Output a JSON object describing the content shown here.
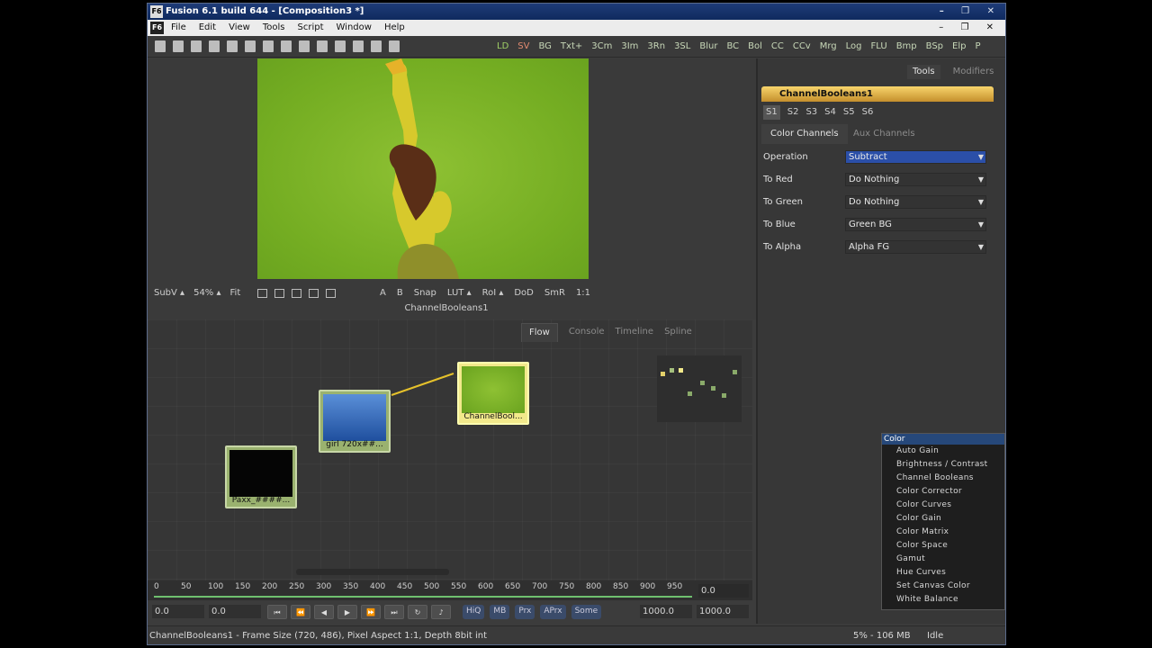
{
  "window": {
    "title": "Fusion 6.1 build 644 - [Composition3 *]",
    "logo": "F6",
    "buttons": "– ❐ ✕"
  },
  "menu": {
    "logo": "F6",
    "items": [
      "File",
      "Edit",
      "View",
      "Tools",
      "Script",
      "Window",
      "Help"
    ],
    "buttons": "– ❐ ✕"
  },
  "toolbar": {
    "tools": [
      "LD",
      "SV",
      "BG",
      "Txt+",
      "3Cm",
      "3Im",
      "3Rn",
      "3SL",
      "Blur",
      "BC",
      "Bol",
      "CC",
      "CCv",
      "Mrg",
      "Log",
      "FLU",
      "Bmp",
      "BSp",
      "Elp",
      "P"
    ]
  },
  "viewer": {
    "controls_left": [
      "SubV ▴",
      "54% ▴",
      "Fit"
    ],
    "controls_right": [
      "A",
      "B",
      "Snap",
      "LUT ▴",
      "RoI ▴",
      "DoD",
      "SmR",
      "1:1"
    ],
    "label": "ChannelBooleans1"
  },
  "flow": {
    "tabs": [
      "Flow",
      "Console",
      "Timeline",
      "Spline"
    ],
    "nodes": [
      {
        "label": "girl 720x##..."
      },
      {
        "label": "ChannelBool..."
      },
      {
        "label": "Paxx_####..."
      }
    ]
  },
  "sidebar": {
    "tabs": [
      "Tools",
      "Modifiers"
    ],
    "tool_name": "ChannelBooleans1",
    "slots": [
      "S1",
      "S2",
      "S3",
      "S4",
      "S5",
      "S6"
    ],
    "channel_tabs": [
      "Color Channels",
      "Aux Channels"
    ],
    "params": [
      {
        "label": "Operation",
        "value": "Subtract"
      },
      {
        "label": "To Red",
        "value": "Do Nothing"
      },
      {
        "label": "To Green",
        "value": "Do Nothing"
      },
      {
        "label": "To Blue",
        "value": "Green BG"
      },
      {
        "label": "To Alpha",
        "value": "Alpha  FG"
      }
    ]
  },
  "color_menu": {
    "header": "Color",
    "items": [
      "Auto Gain",
      "Brightness / Contrast",
      "Channel Booleans",
      "Color Corrector",
      "Color Curves",
      "Color Gain",
      "Color Matrix",
      "Color Space",
      "Gamut",
      "Hue Curves",
      "Set Canvas Color",
      "White Balance"
    ]
  },
  "timeline": {
    "ticks": [
      "0",
      "50",
      "100",
      "150",
      "200",
      "250",
      "300",
      "350",
      "400",
      "450",
      "500",
      "550",
      "600",
      "650",
      "700",
      "750",
      "800",
      "850",
      "900",
      "950"
    ],
    "current": "0.0"
  },
  "transport": {
    "start": "0.0",
    "render_start": "0.0",
    "pills": [
      "HiQ",
      "MB",
      "Prx",
      "APrx",
      "Some"
    ],
    "render_end": "1000.0",
    "end": "1000.0"
  },
  "status": {
    "text": "ChannelBooleans1 - Frame Size (720, 486), Pixel Aspect 1:1, Depth 8bit int",
    "memory": "5% - 106 MB",
    "state": "Idle"
  }
}
